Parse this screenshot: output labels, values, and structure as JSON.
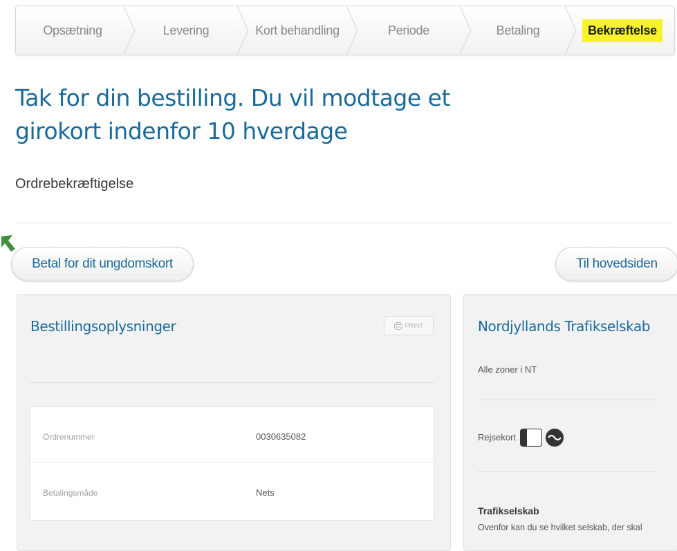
{
  "steps": [
    {
      "label": "Opsætning"
    },
    {
      "label": "Levering"
    },
    {
      "label": "Kort behandling"
    },
    {
      "label": "Periode"
    },
    {
      "label": "Betaling"
    },
    {
      "label": "Bekræftelse",
      "active": true
    }
  ],
  "page": {
    "title": "Tak for din bestilling. Du vil modtage et girokort indenfor 10 hverdage",
    "subtitle": "Ordrebekræftigelse"
  },
  "actions": {
    "pay_label": "Betal for dit ungdomskort",
    "home_label": "Til hovedsiden"
  },
  "order": {
    "heading": "Bestillingsoplysninger",
    "print_label": "PRINT",
    "rows": [
      {
        "label": "Ordrenummer",
        "value": "0030635082"
      },
      {
        "label": "Betalingsmåde",
        "value": "Nets"
      }
    ]
  },
  "company": {
    "heading": "Nordjyllands Trafikselskab",
    "zones": "Alle zoner i NT",
    "rejsekort_label": "Rejsekort",
    "section_heading": "Trafikselskab",
    "section_text": "Ovenfor kan du se hvilket selskab, der skal"
  },
  "colors": {
    "accent": "#1a6a9b",
    "highlight": "#f6f32c",
    "arrow": "#3f8f3f"
  }
}
